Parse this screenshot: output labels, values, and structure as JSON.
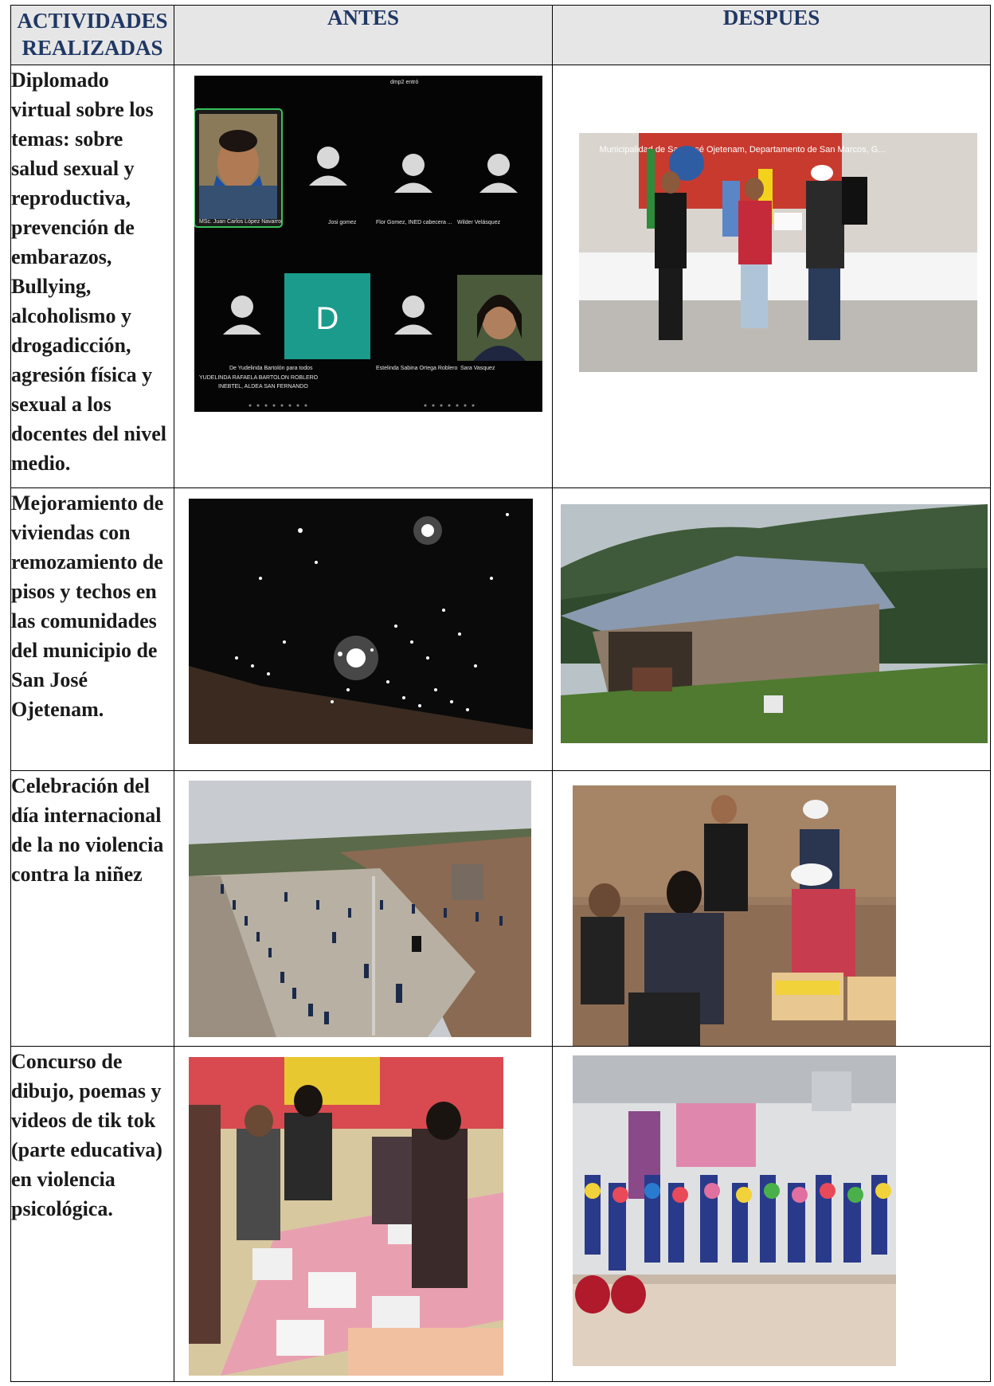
{
  "table": {
    "headers": {
      "activities": "ACTIVIDADES REALIZADAS",
      "before": "ANTES",
      "after": "DESPUES"
    },
    "rows": [
      {
        "activity": "Diplomado virtual  sobre los temas:  sobre salud sexual y reproductiva, prevención de embarazos, Bullying, alcoholismo y drogadicción, agresión física y sexual a los docentes del nivel medio.",
        "before_photo": {
          "notice": "dmp2 entró",
          "participants": [
            "MSc. Juan Carlos López Navarro",
            "Josi gomez",
            "Flor Gomez, INED cabecera ...",
            "Wilder Velásquez",
            "De Yudelinda Bartolón para todos",
            "YUDELINDA RAFAELA BARTOLON ROBLERO",
            "INEBTEL, ALDEA SAN FERNANDO",
            "Estelinda Sabina Ortega Roblero",
            "Sara Vasquez"
          ],
          "avatar_letter": "D",
          "avatar_color": "#1a9b8c"
        },
        "after_photo": {
          "banner_text": "Municipalidad de San José Ojetenam, Departamento de San Marcos, G..."
        }
      },
      {
        "activity": "Mejoramiento de viviendas con remozamiento de pisos y techos en las comunidades del municipio de San José Ojetenam."
      },
      {
        "activity": "Celebración del día internacional de la no violencia contra la niñez"
      },
      {
        "activity": "Concurso de dibujo, poemas y videos de tik tok (parte educativa) en violencia psicológica."
      }
    ]
  },
  "colors": {
    "header_bg": "#e7e6e6",
    "header_text": "#1f3864",
    "border": "#000000"
  }
}
